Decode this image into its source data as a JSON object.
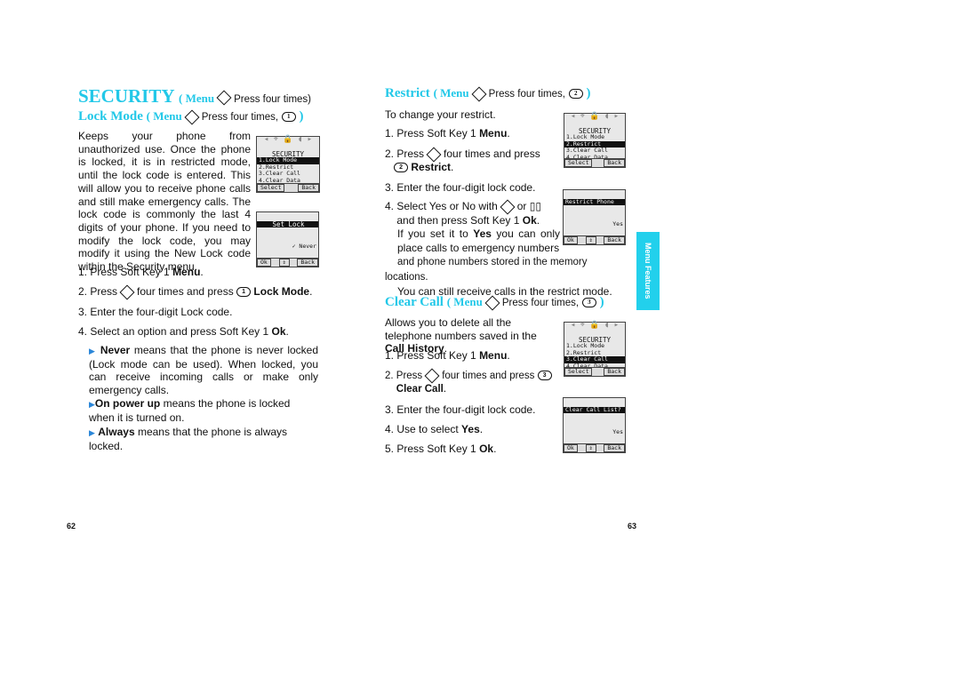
{
  "left": {
    "title": "SECURITY",
    "title_menu": "( Menu",
    "title_rest": "Press four times)",
    "sub": "Lock Mode",
    "sub_menu": "( Menu",
    "sub_rest": "Press four times,",
    "sub_key": "1",
    "sub_close": ")",
    "para": "Keeps your phone from unauthorized use. Once the phone is locked, it is in restricted mode, until the lock code is entered. This will allow you to receive phone calls and still make emergency calls. The lock code is commonly the last 4 digits of your phone. If you need to modify the lock code, you may modify it using the New Lock code within the Security menu.",
    "s1a": "1. Press Soft Key 1 ",
    "s1b": "Menu",
    "s1c": ".",
    "s2a": "2. Press",
    "s2b": "four times and press",
    "s2key": "1",
    "s2c": "Lock Mode",
    "s2d": ".",
    "s3": "3. Enter the four-digit Lock code.",
    "s4a": "4. Select an option and press Soft Key 1 ",
    "s4b": "Ok",
    "s4c": ".",
    "b1a": "Never",
    "b1b": " means that the phone is never locked (Lock mode can be used). When locked, you can receive incoming calls or make only emergency calls.",
    "b2a": "On power up",
    "b2b": " means the phone is locked when it is turned on.",
    "b3a": "Always",
    "b3b": " means that the phone is always locked.",
    "page": "62"
  },
  "right": {
    "restrict_title": "Restrict",
    "restrict_menu": "( Menu",
    "restrict_rest": "Press four times,",
    "restrict_key": "2",
    "restrict_close": ")",
    "intro": "To change your restrict.",
    "r1a": "1. Press Soft Key 1 ",
    "r1b": "Menu",
    "r1c": ".",
    "r2a": "2. Press",
    "r2b": "four times and press",
    "r2key": "2",
    "r2c": "Restrict",
    "r2d": ".",
    "r3": "3. Enter the four-digit lock code.",
    "r4a": "4. Select Yes or No with",
    "r4b": "or",
    "r4c": "and then press Soft Key 1 ",
    "r4d": "Ok",
    "r4e": ".",
    "r4f": "If you set it to ",
    "r4g": "Yes",
    "r4h": " you can only place calls to emergency numbers",
    "r4i": "and phone numbers stored in the memory locations.",
    "r4j": "You can still receive calls in the restrict mode.",
    "clear_title": "Clear Call",
    "clear_menu": "( Menu",
    "clear_rest": "Press four times,",
    "clear_key": "3",
    "clear_close": ")",
    "cintro_a": "Allows you to delete all the telephone numbers saved in the ",
    "cintro_b": "Call History",
    "cintro_c": ".",
    "c1a": "1. Press Soft Key 1 ",
    "c1b": "Menu",
    "c1c": ".",
    "c2a": "2. Press",
    "c2b": "four times and press",
    "c2key": "3",
    "c2c": "Clear Call",
    "c2d": ".",
    "c3": "3. Enter the four-digit lock code.",
    "c4a": "4. Use to select ",
    "c4b": "Yes",
    "c4c": ".",
    "c5a": "5. Press Soft Key 1 ",
    "c5b": "Ok",
    "c5c": ".",
    "tab": "Menu Features",
    "page": "63"
  },
  "screens": {
    "menu_title": "SECURITY",
    "items": [
      "1.Lock Mode",
      "2.Restrict",
      "3.Clear Call",
      "4.Clear Data"
    ],
    "select": "Select",
    "back": "Back",
    "ok": "Ok",
    "setlock": "Set Lock",
    "never": "✓ Never",
    "restrict_phone": "Restrict Phone",
    "yes": "Yes",
    "clear_list": "Clear Call List?"
  }
}
